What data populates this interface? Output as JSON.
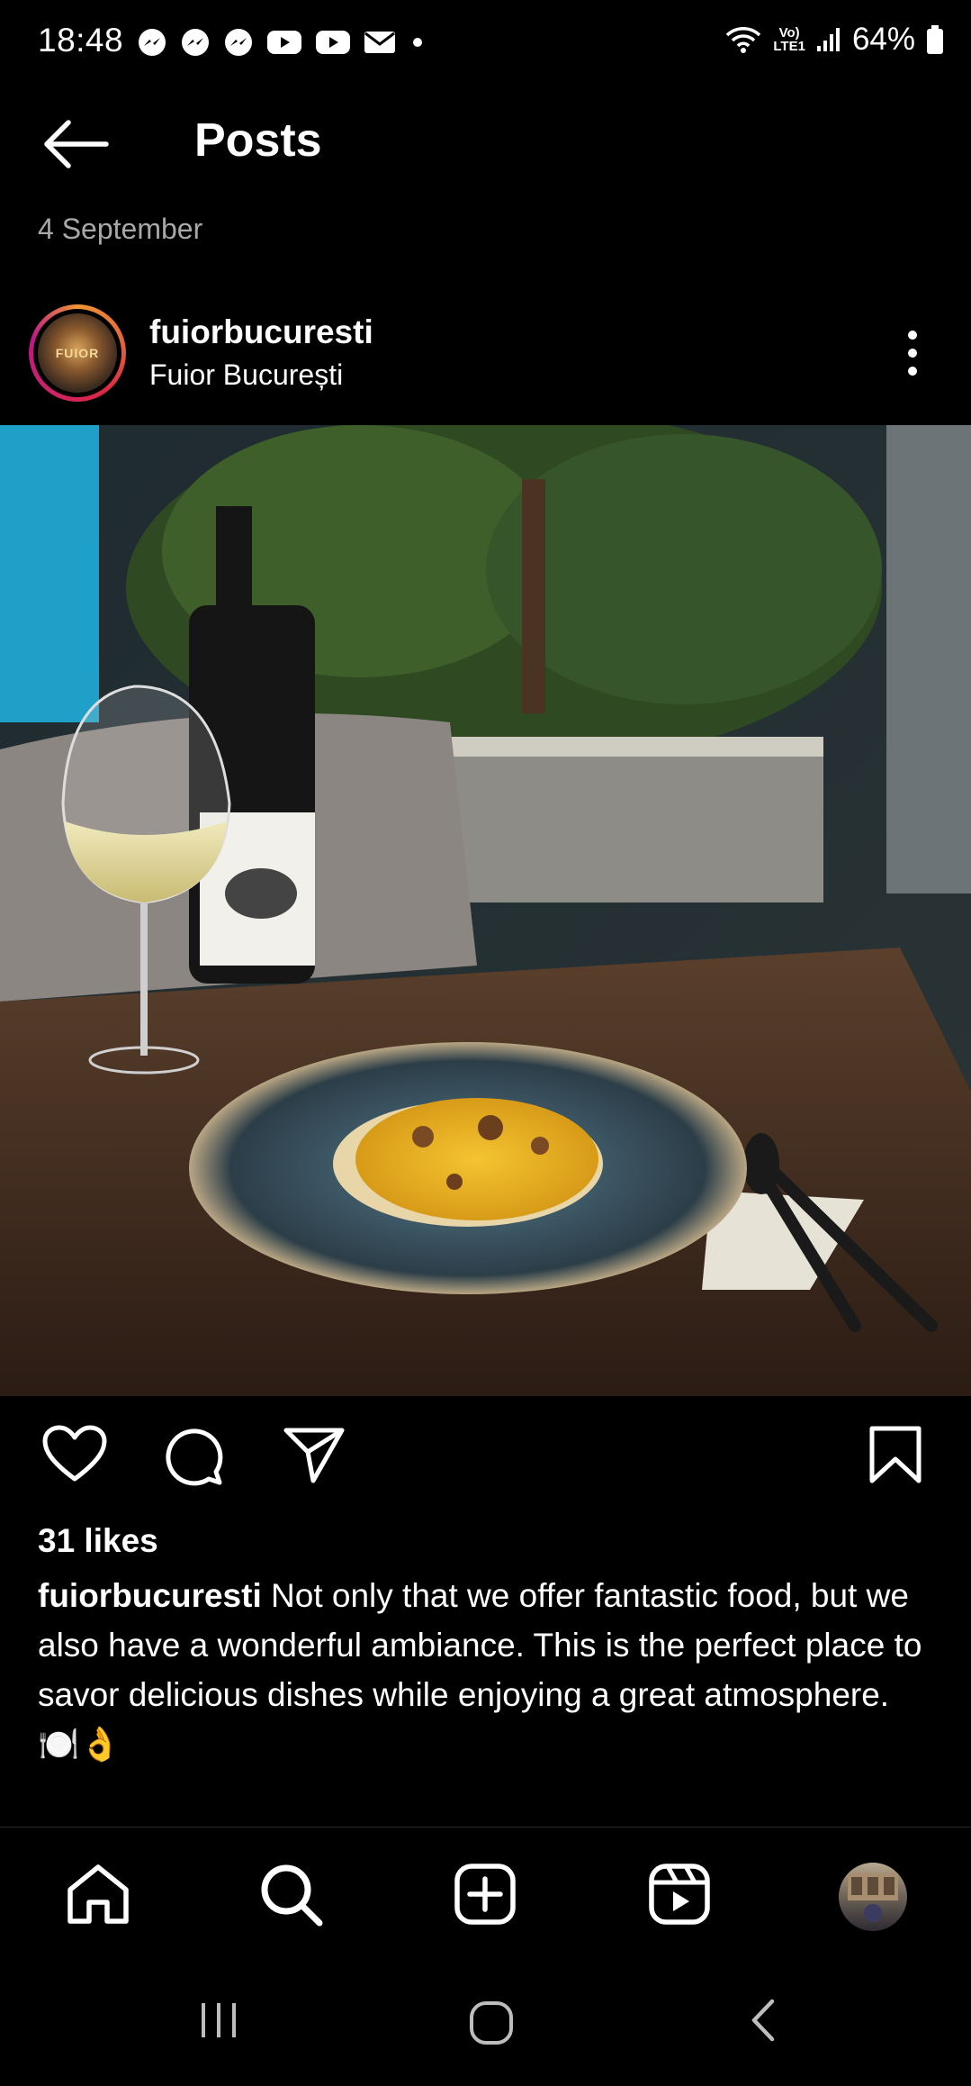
{
  "status_bar": {
    "time": "18:48",
    "notification_icons": [
      "messenger-icon",
      "messenger-icon",
      "messenger-icon",
      "youtube-icon",
      "youtube-icon",
      "mail-icon",
      "dot-icon"
    ],
    "volte_top": "Vo)",
    "volte_bottom": "LTE1",
    "battery": "64%"
  },
  "header": {
    "title": "Posts",
    "back_icon": "arrow-left-icon"
  },
  "post": {
    "date": "4 September",
    "username": "fuiorbucuresti",
    "location": "Fuior București",
    "avatar_text": "FUIOR",
    "likes": "31 likes",
    "caption_user": "fuiorbucuresti",
    "caption_text": " Not only that we offer fantastic food, but we also have a wonderful ambiance. This is the perfect place to savor delicious dishes while enjoying a great atmosphere. 🍽️👌"
  },
  "actions": [
    "heart-icon",
    "comment-icon",
    "share-icon",
    "bookmark-icon"
  ],
  "bottom_nav": [
    "home-icon",
    "search-icon",
    "create-icon",
    "reels-icon",
    "profile-avatar"
  ],
  "system_nav": [
    "recents-icon",
    "home-circle-icon",
    "back-chevron-icon"
  ],
  "colors": {
    "background": "#000000",
    "secondary_text": "#a8a8a8"
  }
}
